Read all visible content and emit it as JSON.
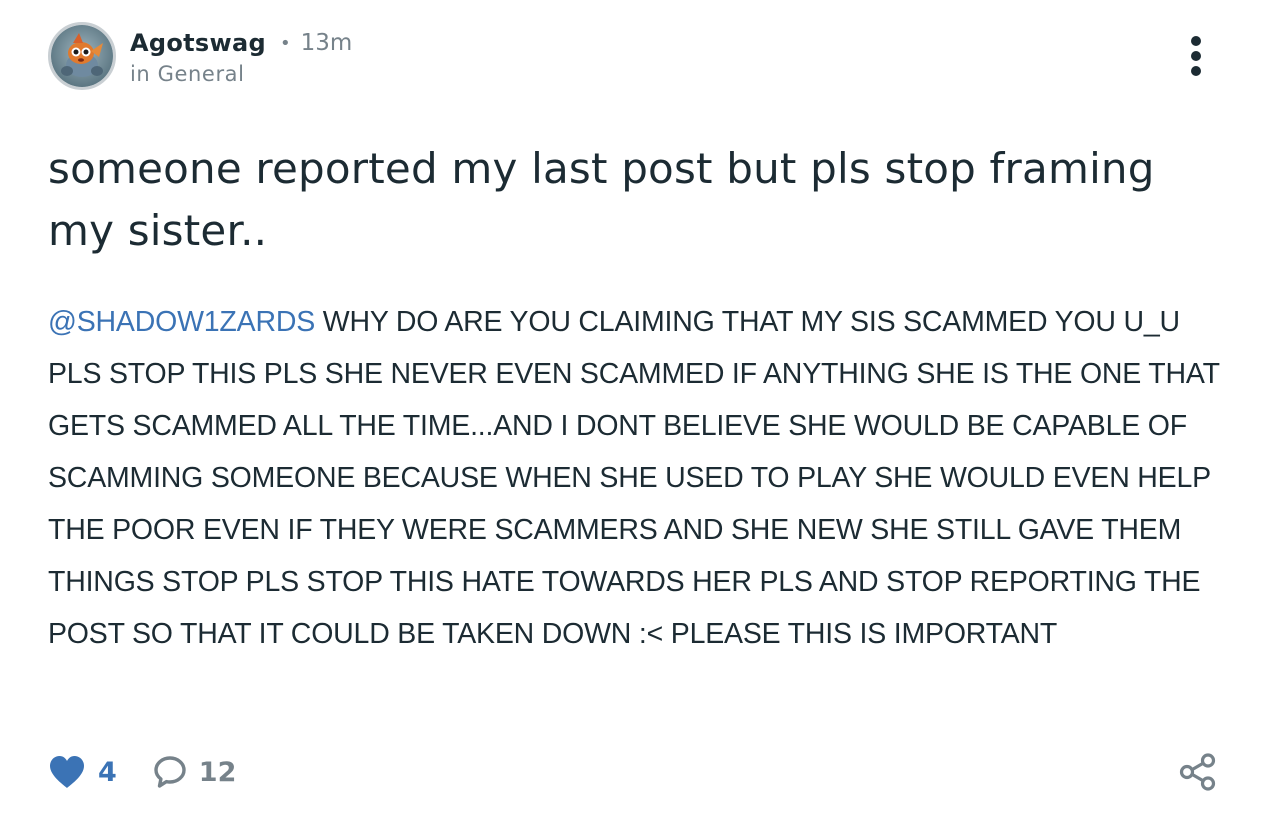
{
  "post": {
    "author": "Agotswag",
    "separator": "•",
    "time": "13m",
    "community": "in General",
    "title": "someone reported my last post but pls stop framing my sister..",
    "mention": "@SHADOW1ZARDS",
    "body": " WHY DO ARE YOU CLAIMING THAT MY SIS SCAMMED YOU U_U PLS STOP THIS PLS SHE NEVER EVEN SCAMMED IF ANYTHING SHE IS THE ONE THAT GETS SCAMMED ALL THE TIME...AND I DONT BELIEVE SHE WOULD BE CAPABLE OF SCAMMING SOMEONE BECAUSE WHEN SHE USED TO PLAY SHE WOULD EVEN HELP THE POOR EVEN IF THEY WERE SCAMMERS AND SHE NEW SHE STILL GAVE THEM THINGS STOP PLS STOP THIS HATE TOWARDS HER PLS AND STOP REPORTING THE POST SO THAT IT COULD BE TAKEN DOWN :< PLEASE THIS IS IMPORTANT",
    "likes": "4",
    "comments": "12"
  },
  "icons": {
    "avatar": "user-avatar-goldfish",
    "more": "vertical-ellipsis-icon",
    "like": "heart-icon",
    "comment": "speech-bubble-icon",
    "share": "share-icon"
  },
  "colors": {
    "text": "#1c2b33",
    "muted": "#76828a",
    "accent": "#3b73b5"
  }
}
